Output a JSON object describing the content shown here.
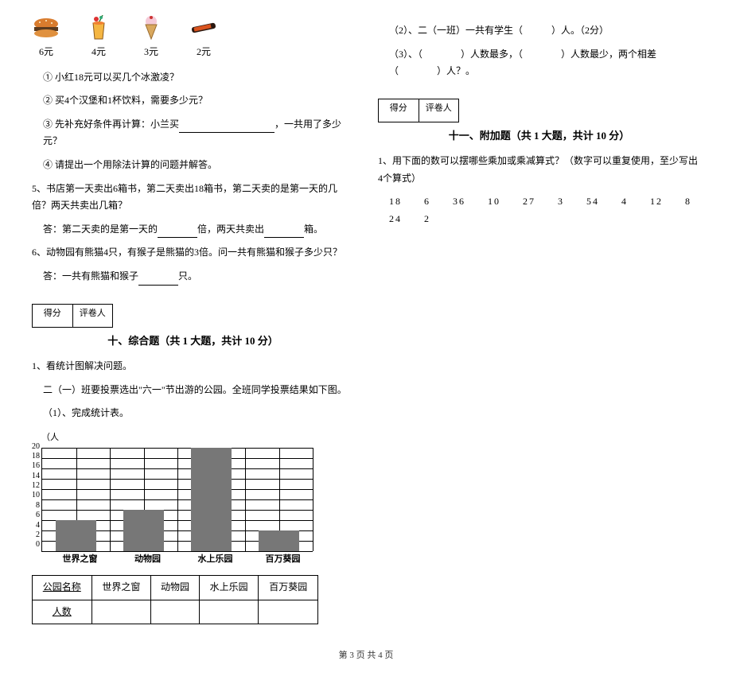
{
  "left": {
    "items": [
      {
        "name": "burger",
        "price": "6元"
      },
      {
        "name": "drink",
        "price": "4元"
      },
      {
        "name": "icecream",
        "price": "3元"
      },
      {
        "name": "chocolate",
        "price": "2元"
      }
    ],
    "q1": "① 小红18元可以买几个冰激凌？",
    "q2": "② 买4个汉堡和1杯饮料，需要多少元？",
    "q3_a": "③ 先补充好条件再计算：小兰买",
    "q3_b": "，一共用了多少元？",
    "q4": "④ 请提出一个用除法计算的问题并解答。",
    "q5": "5、书店第一天卖出6箱书，第二天卖出18箱书，第二天卖的是第一天的几倍？两天共卖出几箱？",
    "q5_ans_a": "答：第二天卖的是第一天的",
    "q5_ans_b": "倍，两天共卖出",
    "q5_ans_c": "箱。",
    "q6": "6、动物园有熊猫4只，有猴子是熊猫的3倍。问一共有熊猫和猴子多少只？",
    "q6_ans_a": "答：一共有熊猫和猴子",
    "q6_ans_b": "只。",
    "score_label_1": "得分",
    "score_label_2": "评卷人",
    "section10_title": "十、综合题（共 1 大题，共计 10 分）",
    "s10_q1": "1、看统计图解决问题。",
    "s10_q1_desc": "二（一）班要投票选出\"六一\"节出游的公园。全班同学投票结果如下图。",
    "s10_q1_1": "（1）、完成统计表。",
    "chart_ylabel": "（人",
    "chart_data": {
      "type": "bar",
      "categories": [
        "世界之窗",
        "动物园",
        "水上乐园",
        "百万葵园"
      ],
      "values": [
        6,
        8,
        20,
        4
      ],
      "xlabel": "",
      "ylabel": "人",
      "ylim": [
        0,
        20
      ],
      "y_ticks": [
        20,
        18,
        16,
        14,
        12,
        10,
        8,
        6,
        4,
        2,
        0
      ]
    },
    "table_header": "公园名称",
    "table_row2": "人数"
  },
  "right": {
    "q2": "（2）、二（一班）一共有学生（　　　）人。（2分）",
    "q3": "（3）、（　　　　）人数最多，（　　　　）人数最少，两个相差（　　　　）人？。",
    "score_label_1": "得分",
    "score_label_2": "评卷人",
    "section11_title": "十一、附加题（共 1 大题，共计 10 分）",
    "s11_q1": "1、用下面的数可以摆哪些乘加或乘减算式？（数字可以重复使用，至少写出4个算式）",
    "numbers": "18　　6　　36　　10　　27　　3　　54　　4　　12　　8　　24　　2"
  },
  "footer": "第 3 页 共 4 页"
}
